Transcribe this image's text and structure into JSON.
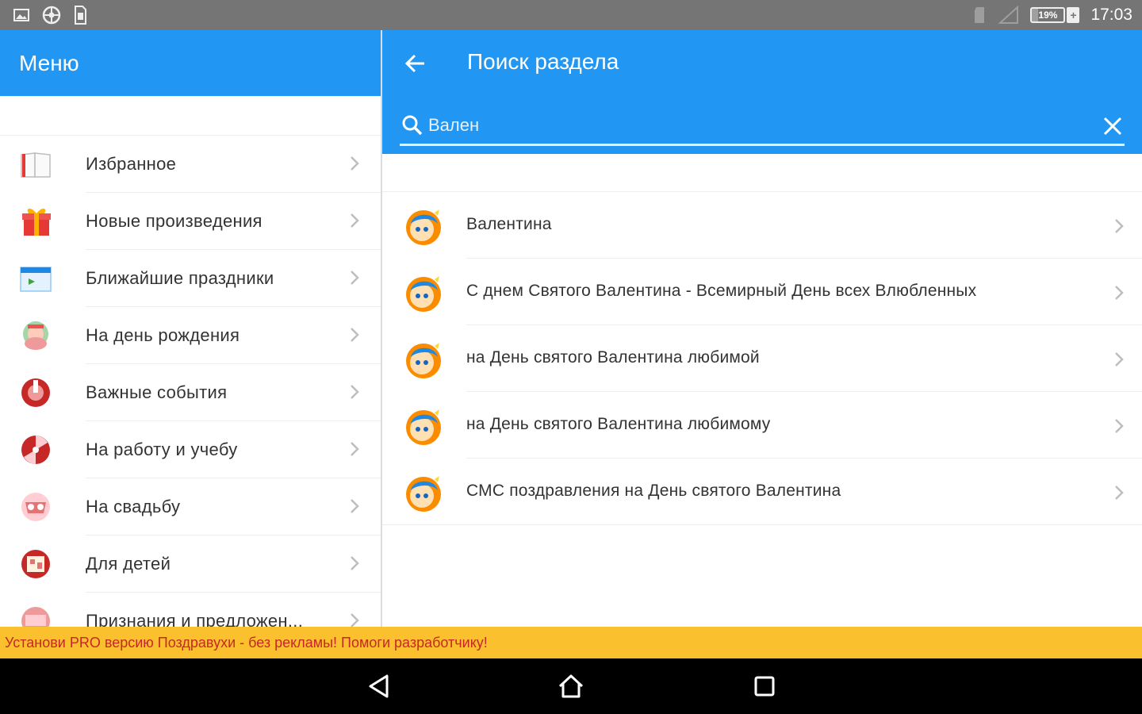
{
  "status_bar": {
    "battery_percent": "19%",
    "battery_level": 0.19,
    "time": "17:03",
    "icons": [
      "image-icon",
      "settings-icon",
      "sim-icon",
      "sd-card-icon",
      "signal-icon",
      "battery-charging-icon"
    ]
  },
  "colors": {
    "primary": "#2196f3",
    "status_bar": "#757575",
    "promo_background": "#fbc02d",
    "promo_text": "#c62828",
    "nav_bar": "#000000"
  },
  "menu": {
    "title": "Меню",
    "items": [
      {
        "label": "Избранное",
        "icon": "book-icon"
      },
      {
        "label": "Новые произведения",
        "icon": "gift-icon"
      },
      {
        "label": "Ближайшие праздники",
        "icon": "calendar-icon"
      },
      {
        "label": "На день рождения",
        "icon": "birthday-icon"
      },
      {
        "label": "Важные события",
        "icon": "events-icon"
      },
      {
        "label": "На работу и учебу",
        "icon": "work-icon"
      },
      {
        "label": "На свадьбу",
        "icon": "wedding-icon"
      },
      {
        "label": "Для детей",
        "icon": "kids-icon"
      },
      {
        "label": "Признания и предложен...",
        "icon": "love-icon"
      }
    ]
  },
  "search_panel": {
    "title": "Поиск раздела",
    "search_value": "Вален",
    "results": [
      {
        "label": "Валентина",
        "icon": "cupid-avatar-icon"
      },
      {
        "label": "С днем Святого Валентина - Всемирный День всех Влюбленных",
        "icon": "cupid-avatar-icon"
      },
      {
        "label": "на День святого Валентина любимой",
        "icon": "cupid-avatar-icon"
      },
      {
        "label": "на День святого Валентина любимому",
        "icon": "cupid-avatar-icon"
      },
      {
        "label": "СМС поздравления на День святого Валентина",
        "icon": "cupid-avatar-icon"
      }
    ]
  },
  "promo_banner": {
    "text": "Установи PRO версию Поздравухи - без рекламы! Помоги разработчику!"
  },
  "nav_bar": {
    "buttons": [
      "back-nav-icon",
      "home-nav-icon",
      "recents-nav-icon"
    ]
  }
}
